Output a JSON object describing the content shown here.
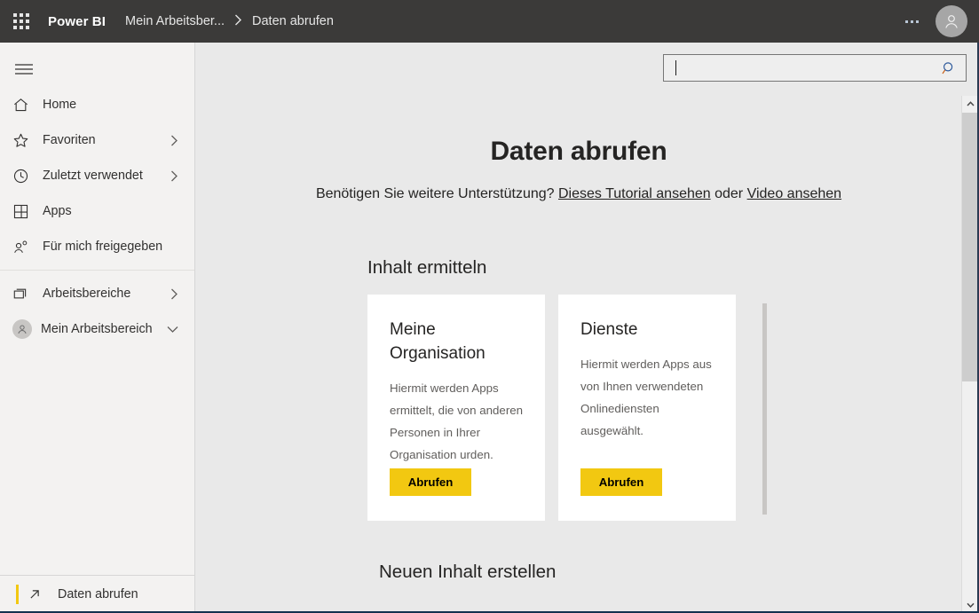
{
  "topbar": {
    "app_launcher_icon": "waffle-grid-icon",
    "brand": "Power BI",
    "breadcrumbs": [
      {
        "label": "Mein Arbeitsber...",
        "icon": ""
      },
      {
        "label": "Daten abrufen",
        "icon": ""
      }
    ],
    "breadcrumb_separator": "›",
    "more_options_icon": "ellipsis-icon",
    "account_icon": "person-icon",
    "background": "#3b3a39"
  },
  "sidebar": {
    "menu_toggle_icon": "hamburger-icon",
    "items": [
      {
        "label": "Home",
        "icon": "home-icon",
        "chevron": false
      },
      {
        "label": "Favoriten",
        "icon": "star-icon",
        "chevron": true
      },
      {
        "label": "Zuletzt verwendet",
        "icon": "clock-icon",
        "chevron": true
      },
      {
        "label": "Apps",
        "icon": "apps-grid-icon",
        "chevron": false
      },
      {
        "label": "Für mich freigegeben",
        "icon": "shared-person-icon",
        "chevron": false
      }
    ],
    "group_items": [
      {
        "label": "Arbeitsbereiche",
        "icon": "workspaces-icon",
        "chevron": true
      },
      {
        "label": "Mein Arbeitsbereich",
        "icon": "person-avatar-icon",
        "chevron_down": true
      }
    ],
    "bottom": {
      "label": "Daten abrufen",
      "icon": "arrow-up-right-icon",
      "accent_color": "#f2c811",
      "selected": true
    }
  },
  "search": {
    "value": "",
    "placeholder": "",
    "icon": "magnifier-icon"
  },
  "main": {
    "title": "Daten abrufen",
    "subtitle_prefix": "Benötigen Sie weitere Unterstützung?",
    "subtitle_link1": "Dieses Tutorial ansehen",
    "subtitle_middle": "oder",
    "subtitle_link2": "Video ansehen",
    "section1_title": "Inhalt ermitteln",
    "section2_title": "Neuen Inhalt erstellen",
    "cards": [
      {
        "title": "Meine Organisation",
        "description": "Hiermit werden Apps ermittelt, die von anderen Personen in Ihrer Organisation",
        "description_tail": "urden.",
        "button_label": "Abrufen"
      },
      {
        "title": "Dienste",
        "description": "Hiermit werden Apps aus von Ihnen verwendeten Onlinediensten ausgewählt.",
        "description_tail": "",
        "button_label": "Abrufen"
      }
    ]
  },
  "scrollbar": {
    "up_icon": "chevron-up-icon",
    "down_icon": "chevron-down-icon"
  },
  "colors": {
    "accent_yellow": "#f2c811",
    "topbar": "#3b3a39",
    "sidebar": "#f3f2f1",
    "content": "#e9e9e9"
  }
}
